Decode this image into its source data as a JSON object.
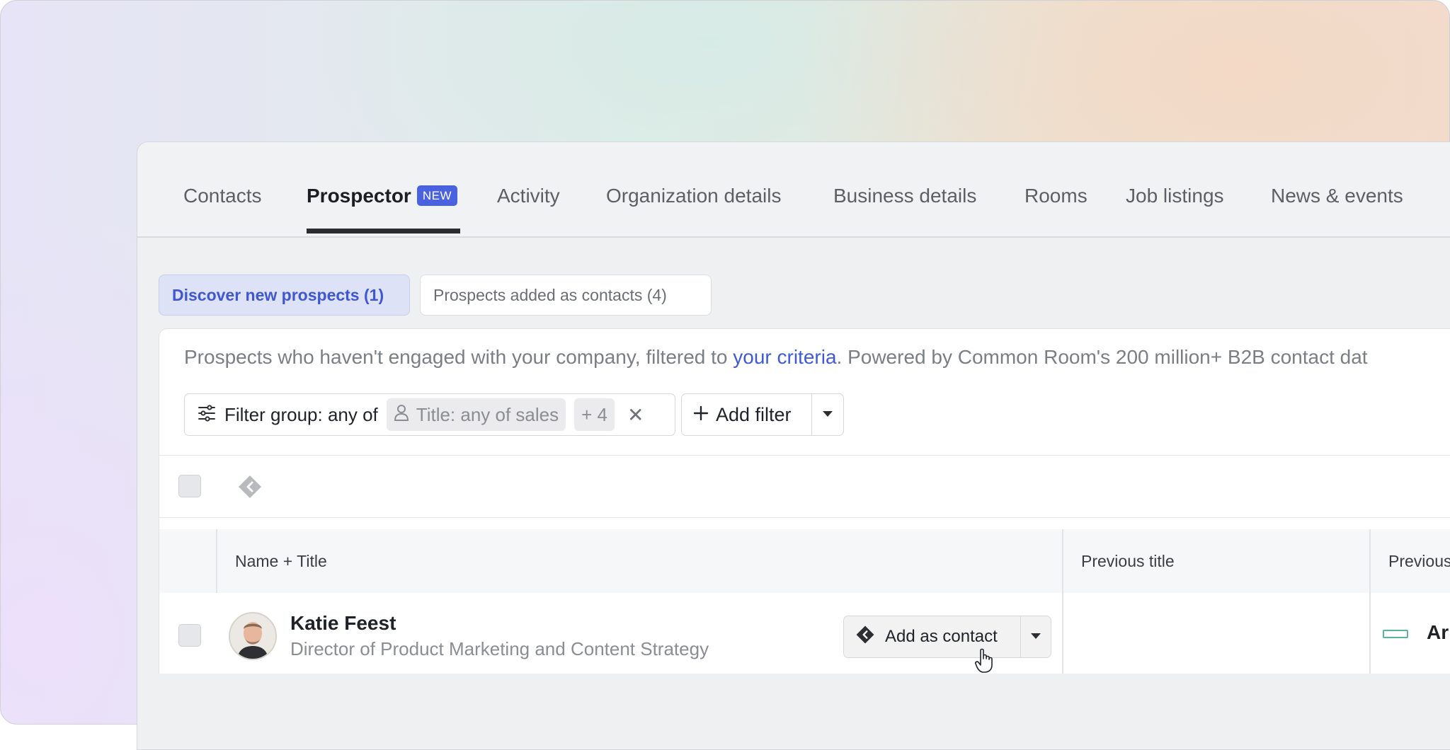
{
  "tabs": [
    {
      "label": "Contacts",
      "active": false
    },
    {
      "label": "Prospector",
      "active": true,
      "badge": "NEW"
    },
    {
      "label": "Activity",
      "active": false
    },
    {
      "label": "Organization details",
      "active": false
    },
    {
      "label": "Business details",
      "active": false
    },
    {
      "label": "Rooms",
      "active": false
    },
    {
      "label": "Job listings",
      "active": false
    },
    {
      "label": "News & events",
      "active": false
    }
  ],
  "subtabs": {
    "discover": "Discover new prospects  (1)",
    "added": "Prospects added as contacts  (4)"
  },
  "description": {
    "before": "Prospects who haven't engaged with your company, filtered to ",
    "link": "your criteria",
    "after": ". Powered by Common Room's 200 million+ B2B contact dat"
  },
  "filters": {
    "group_label": "Filter group: any of",
    "chip_label": "Title: any of sales",
    "more_count": "+ 4",
    "add_filter_label": "Add filter"
  },
  "table": {
    "columns": [
      "Name + Title",
      "Previous title",
      "Previous"
    ],
    "rows": [
      {
        "name": "Katie Feest",
        "title": "Director of Product Marketing and Content Strategy",
        "action_label": "Add as contact",
        "previous_company": "Ar"
      }
    ]
  },
  "colors": {
    "accent": "#4a61e0",
    "link": "#3f5ad8",
    "company_icon": "#58b59a"
  }
}
